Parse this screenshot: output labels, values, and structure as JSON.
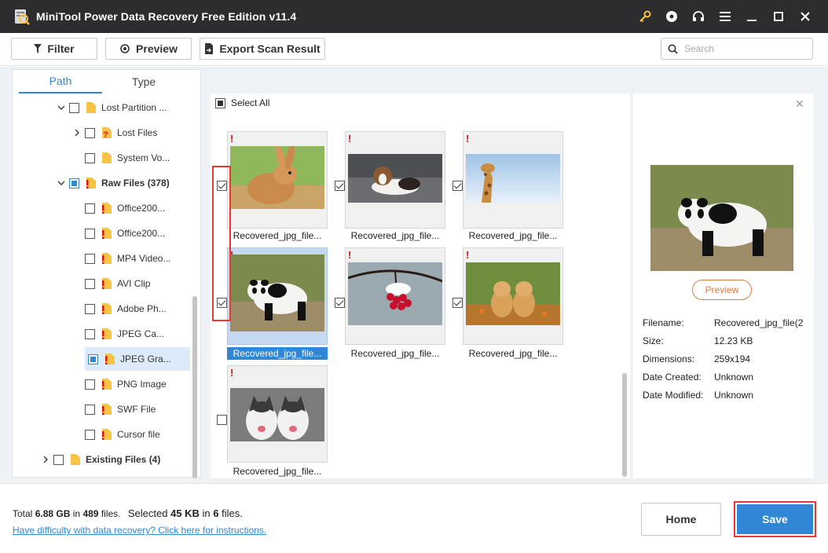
{
  "app": {
    "title": "MiniTool Power Data Recovery Free Edition v11.4",
    "window_icons": [
      "key-icon",
      "disc-icon",
      "headset-icon",
      "menu-icon",
      "minimize-icon",
      "maximize-icon",
      "close-icon"
    ]
  },
  "toolbar": {
    "filter_label": "Filter",
    "preview_label": "Preview",
    "export_label": "Export Scan Result",
    "search_placeholder": "Search"
  },
  "tabs": {
    "path_label": "Path",
    "type_label": "Type",
    "active": "Path"
  },
  "tree": [
    {
      "label": "Lost Partition ...",
      "icon": "folder",
      "state": "unchecked",
      "expander": "expanded"
    },
    {
      "label": "Lost Files",
      "icon": "folder-question",
      "state": "unchecked",
      "expander": "collapsed"
    },
    {
      "label": "System Vo...",
      "icon": "folder",
      "state": "unchecked",
      "expander": "none"
    },
    {
      "label": "Raw Files (378)",
      "icon": "folder-warning",
      "state": "partial",
      "expander": "expanded",
      "bold": true
    },
    {
      "label": "Office200...",
      "icon": "folder-warning",
      "state": "unchecked"
    },
    {
      "label": "Office200...",
      "icon": "folder-warning",
      "state": "unchecked"
    },
    {
      "label": "MP4 Video...",
      "icon": "folder-warning",
      "state": "unchecked"
    },
    {
      "label": "AVI Clip",
      "icon": "folder-warning",
      "state": "unchecked"
    },
    {
      "label": "Adobe Ph...",
      "icon": "folder-warning",
      "state": "unchecked"
    },
    {
      "label": "JPEG Ca...",
      "icon": "folder-warning",
      "state": "unchecked"
    },
    {
      "label": "JPEG Gra...",
      "icon": "folder-warning",
      "state": "partial",
      "selected": true
    },
    {
      "label": "PNG Image",
      "icon": "folder-warning",
      "state": "unchecked"
    },
    {
      "label": "SWF File",
      "icon": "folder-warning",
      "state": "unchecked"
    },
    {
      "label": "Cursor file",
      "icon": "folder-warning",
      "state": "unchecked"
    },
    {
      "label": "Existing Files (4)",
      "icon": "folder",
      "state": "unchecked",
      "expander": "collapsed",
      "bold": true
    }
  ],
  "grid": {
    "select_all_label": "Select All",
    "select_all_state": "partial",
    "items": [
      {
        "label": "Recovered_jpg_file...",
        "image": "rabbit",
        "checked": true
      },
      {
        "label": "Recovered_jpg_file...",
        "image": "puppy",
        "checked": true
      },
      {
        "label": "Recovered_jpg_file...",
        "image": "giraffe",
        "checked": true
      },
      {
        "label": "Recovered_jpg_file...",
        "image": "panda",
        "checked": true,
        "selected": true
      },
      {
        "label": "Recovered_jpg_file...",
        "image": "berries",
        "checked": true
      },
      {
        "label": "Recovered_jpg_file...",
        "image": "dogs",
        "checked": true
      },
      {
        "label": "Recovered_jpg_file...",
        "image": "huskies",
        "checked": false
      }
    ]
  },
  "details": {
    "preview_label": "Preview",
    "filename_key": "Filename:",
    "filename_val": "Recovered_jpg_file(2",
    "size_key": "Size:",
    "size_val": "12.23 KB",
    "dimensions_key": "Dimensions:",
    "dimensions_val": "259x194",
    "created_key": "Date Created:",
    "created_val": "Unknown",
    "modified_key": "Date Modified:",
    "modified_val": "Unknown"
  },
  "footer": {
    "total_prefix": "Total",
    "total_size": "6.88 GB",
    "total_in": "in",
    "total_count": "489",
    "total_suffix": "files.",
    "selected_prefix": "Selected",
    "selected_size": "45 KB",
    "selected_in": "in",
    "selected_count": "6",
    "selected_suffix": "files.",
    "help_link": "Have difficulty with data recovery? Click here for instructions.",
    "home_label": "Home",
    "save_label": "Save"
  },
  "colors": {
    "accent": "#2f87d6",
    "titlebar": "#2d2d30",
    "highlight": "#e53935",
    "warning": "#dd1111",
    "folder": "#f6c343"
  }
}
